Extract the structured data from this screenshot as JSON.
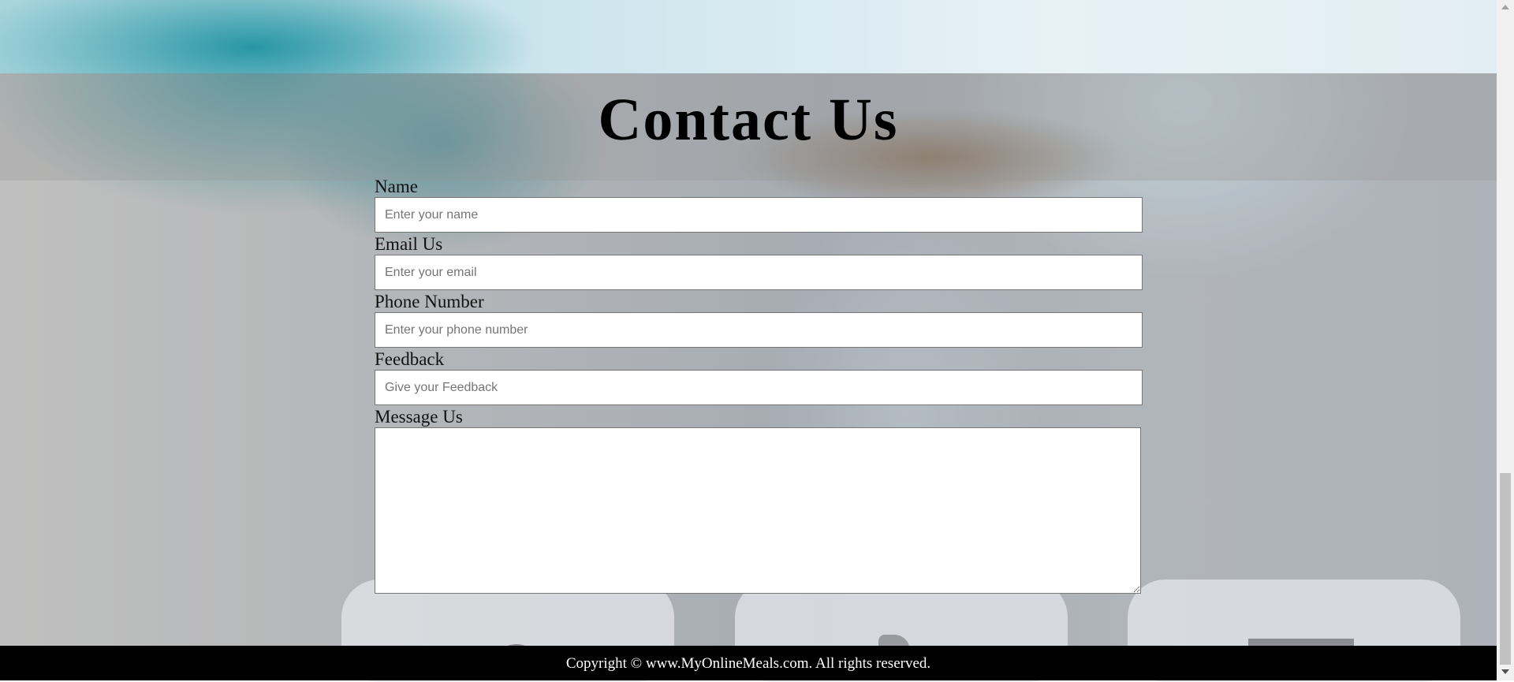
{
  "header": {
    "title": "Contact Us"
  },
  "form": {
    "fields": [
      {
        "label": "Name",
        "placeholder": "Enter your name",
        "value": ""
      },
      {
        "label": "Email Us",
        "placeholder": "Enter your email",
        "value": ""
      },
      {
        "label": "Phone Number",
        "placeholder": "Enter your phone number",
        "value": ""
      },
      {
        "label": "Feedback",
        "placeholder": "Give your Feedback",
        "value": ""
      }
    ],
    "message": {
      "label": "Message Us",
      "value": ""
    }
  },
  "footer": {
    "copyright": "Copyright © www.MyOnlineMeals.com. All rights reserved."
  },
  "colors": {
    "footer_bg": "#000000",
    "footer_text": "#ffffff"
  }
}
